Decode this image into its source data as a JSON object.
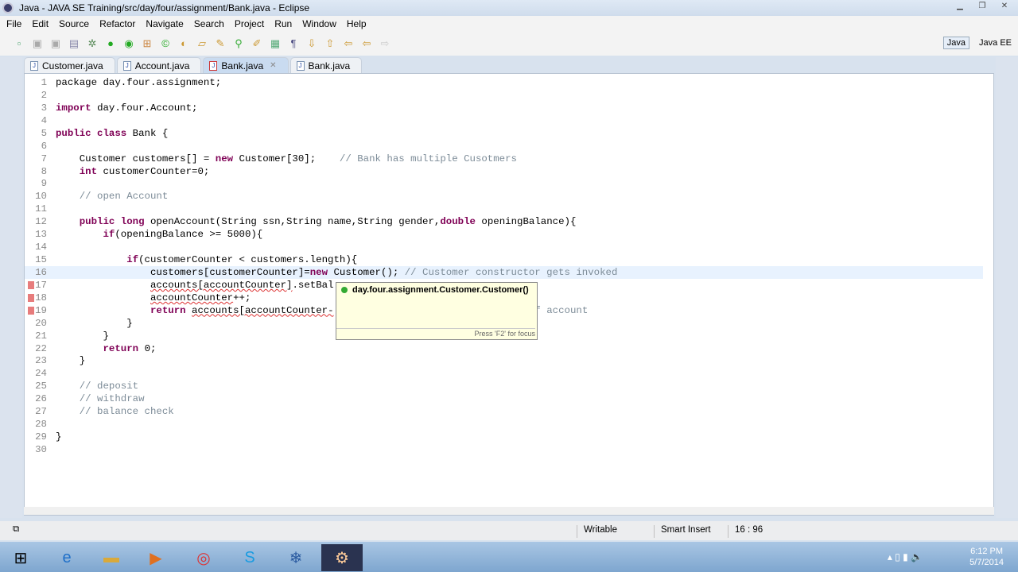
{
  "window": {
    "title": "Java - JAVA SE Training/src/day/four/assignment/Bank.java - Eclipse"
  },
  "menu": [
    "File",
    "Edit",
    "Source",
    "Refactor",
    "Navigate",
    "Search",
    "Project",
    "Run",
    "Window",
    "Help"
  ],
  "perspectives": {
    "java": "Java",
    "javaee": "Java EE"
  },
  "tabs": [
    {
      "label": "Customer.java"
    },
    {
      "label": "Account.java"
    },
    {
      "label": "Bank.java",
      "active": true
    },
    {
      "label": "Bank.java"
    }
  ],
  "code": {
    "current_line": 16,
    "error_lines": [
      17,
      18,
      19
    ],
    "lines": [
      [
        [
          "package day.four.assignment;",
          ""
        ]
      ],
      [],
      [
        [
          "import ",
          "k"
        ],
        [
          "day.four.Account;",
          ""
        ]
      ],
      [],
      [
        [
          "public class ",
          "k"
        ],
        [
          "Bank {",
          ""
        ]
      ],
      [],
      [
        [
          "    Customer customers[] = ",
          ""
        ],
        [
          "new ",
          "k"
        ],
        [
          "Customer[30];    ",
          ""
        ],
        [
          "// Bank has multiple Cusotmers",
          "c"
        ]
      ],
      [
        [
          "    ",
          ""
        ],
        [
          "int ",
          "k"
        ],
        [
          "customerCounter=0;",
          ""
        ]
      ],
      [],
      [
        [
          "    // open Account",
          "c"
        ]
      ],
      [],
      [
        [
          "    ",
          ""
        ],
        [
          "public long ",
          "k"
        ],
        [
          "openAccount(String ssn,String name,String gender,",
          ""
        ],
        [
          "double ",
          "k"
        ],
        [
          "openingBalance){",
          ""
        ]
      ],
      [
        [
          "        ",
          ""
        ],
        [
          "if",
          "k"
        ],
        [
          "(openingBalance >= 5000){",
          ""
        ]
      ],
      [],
      [
        [
          "            ",
          ""
        ],
        [
          "if",
          "k"
        ],
        [
          "(customerCounter < customers.length){",
          ""
        ]
      ],
      [
        [
          "                customers[customerCounter]=",
          ""
        ],
        [
          "new ",
          "k"
        ],
        [
          "Customer(); ",
          ""
        ],
        [
          "// Customer constructor gets invoked",
          "c"
        ]
      ],
      [
        [
          "                ",
          ""
        ],
        [
          "accounts[accountCounter]",
          "e"
        ],
        [
          ".setBal",
          ""
        ]
      ],
      [
        [
          "                ",
          ""
        ],
        [
          "accountCounter",
          "e"
        ],
        [
          "++;",
          ""
        ]
      ],
      [
        [
          "                ",
          ""
        ],
        [
          "return ",
          "k"
        ],
        [
          "accounts[accountCounter-",
          "e"
        ],
        [
          "                     ",
          ""
        ],
        [
          "ul creation of account",
          "c"
        ]
      ],
      [
        [
          "            }",
          ""
        ]
      ],
      [
        [
          "        }",
          ""
        ]
      ],
      [
        [
          "        ",
          ""
        ],
        [
          "return ",
          "k"
        ],
        [
          "0;",
          ""
        ]
      ],
      [
        [
          "    }",
          ""
        ]
      ],
      [],
      [
        [
          "    // deposit",
          "c"
        ]
      ],
      [
        [
          "    // withdraw",
          "c"
        ]
      ],
      [
        [
          "    // balance check",
          "c"
        ]
      ],
      [],
      [
        [
          "}",
          ""
        ]
      ],
      []
    ]
  },
  "popup": {
    "item": "day.four.assignment.Customer.Customer()",
    "footer": "Press 'F2' for focus"
  },
  "status": {
    "writable": "Writable",
    "insert_mode": "Smart Insert",
    "position": "16 : 96"
  },
  "tray": {
    "time": "6:12 PM",
    "date": "5/7/2014"
  }
}
